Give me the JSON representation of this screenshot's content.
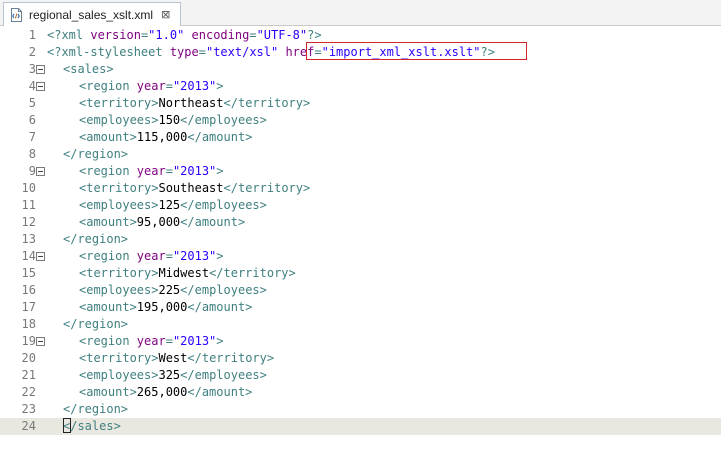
{
  "tab": {
    "icon": "xml-file-icon",
    "title": "regional_sales_xslt.xml",
    "close_glyph": "⊠"
  },
  "editor": {
    "current_line": 24,
    "highlight": "href=\"import_xml_xslt.xslt\"",
    "lines": [
      {
        "n": "1",
        "indent": 0,
        "fold": false,
        "parts": [
          [
            "pi",
            "<?xml "
          ],
          [
            "attr",
            "version"
          ],
          [
            "pi",
            "="
          ],
          [
            "val",
            "\"1.0\""
          ],
          [
            "pi",
            " "
          ],
          [
            "attr",
            "encoding"
          ],
          [
            "pi",
            "="
          ],
          [
            "val",
            "\"UTF-8\""
          ],
          [
            "pi",
            "?>"
          ]
        ]
      },
      {
        "n": "2",
        "indent": 0,
        "fold": false,
        "parts": [
          [
            "pi",
            "<?xml-stylesheet "
          ],
          [
            "attr",
            "type"
          ],
          [
            "pi",
            "="
          ],
          [
            "val",
            "\"text/xsl\""
          ],
          [
            "pi",
            " "
          ],
          [
            "attr",
            "href"
          ],
          [
            "pi",
            "="
          ],
          [
            "val",
            "\"import_xml_xslt.xslt\""
          ],
          [
            "pi",
            "?>"
          ]
        ]
      },
      {
        "n": "3",
        "indent": 1,
        "fold": true,
        "parts": [
          [
            "tag",
            "<sales>"
          ]
        ]
      },
      {
        "n": "4",
        "indent": 2,
        "fold": true,
        "parts": [
          [
            "tag",
            "<region "
          ],
          [
            "attr",
            "year"
          ],
          [
            "tag",
            "="
          ],
          [
            "val",
            "\"2013\""
          ],
          [
            "tag",
            ">"
          ]
        ]
      },
      {
        "n": "5",
        "indent": 2,
        "fold": false,
        "parts": [
          [
            "tag",
            "<territory>"
          ],
          [
            "text",
            "Northeast"
          ],
          [
            "tag",
            "</territory>"
          ]
        ]
      },
      {
        "n": "6",
        "indent": 2,
        "fold": false,
        "parts": [
          [
            "tag",
            "<employees>"
          ],
          [
            "text",
            "150"
          ],
          [
            "tag",
            "</employees>"
          ]
        ]
      },
      {
        "n": "7",
        "indent": 2,
        "fold": false,
        "parts": [
          [
            "tag",
            "<amount>"
          ],
          [
            "text",
            "115,000"
          ],
          [
            "tag",
            "</amount>"
          ]
        ]
      },
      {
        "n": "8",
        "indent": 1,
        "fold": false,
        "parts": [
          [
            "tag",
            "</region>"
          ]
        ]
      },
      {
        "n": "9",
        "indent": 2,
        "fold": true,
        "parts": [
          [
            "tag",
            "<region "
          ],
          [
            "attr",
            "year"
          ],
          [
            "tag",
            "="
          ],
          [
            "val",
            "\"2013\""
          ],
          [
            "tag",
            ">"
          ]
        ]
      },
      {
        "n": "10",
        "indent": 2,
        "fold": false,
        "parts": [
          [
            "tag",
            "<territory>"
          ],
          [
            "text",
            "Southeast"
          ],
          [
            "tag",
            "</territory>"
          ]
        ]
      },
      {
        "n": "11",
        "indent": 2,
        "fold": false,
        "parts": [
          [
            "tag",
            "<employees>"
          ],
          [
            "text",
            "125"
          ],
          [
            "tag",
            "</employees>"
          ]
        ]
      },
      {
        "n": "12",
        "indent": 2,
        "fold": false,
        "parts": [
          [
            "tag",
            "<amount>"
          ],
          [
            "text",
            "95,000"
          ],
          [
            "tag",
            "</amount>"
          ]
        ]
      },
      {
        "n": "13",
        "indent": 1,
        "fold": false,
        "parts": [
          [
            "tag",
            "</region>"
          ]
        ]
      },
      {
        "n": "14",
        "indent": 2,
        "fold": true,
        "parts": [
          [
            "tag",
            "<region "
          ],
          [
            "attr",
            "year"
          ],
          [
            "tag",
            "="
          ],
          [
            "val",
            "\"2013\""
          ],
          [
            "tag",
            ">"
          ]
        ]
      },
      {
        "n": "15",
        "indent": 2,
        "fold": false,
        "parts": [
          [
            "tag",
            "<territory>"
          ],
          [
            "text",
            "Midwest"
          ],
          [
            "tag",
            "</territory>"
          ]
        ]
      },
      {
        "n": "16",
        "indent": 2,
        "fold": false,
        "parts": [
          [
            "tag",
            "<employees>"
          ],
          [
            "text",
            "225"
          ],
          [
            "tag",
            "</employees>"
          ]
        ]
      },
      {
        "n": "17",
        "indent": 2,
        "fold": false,
        "parts": [
          [
            "tag",
            "<amount>"
          ],
          [
            "text",
            "195,000"
          ],
          [
            "tag",
            "</amount>"
          ]
        ]
      },
      {
        "n": "18",
        "indent": 1,
        "fold": false,
        "parts": [
          [
            "tag",
            "</region>"
          ]
        ]
      },
      {
        "n": "19",
        "indent": 2,
        "fold": true,
        "parts": [
          [
            "tag",
            "<region "
          ],
          [
            "attr",
            "year"
          ],
          [
            "tag",
            "="
          ],
          [
            "val",
            "\"2013\""
          ],
          [
            "tag",
            ">"
          ]
        ]
      },
      {
        "n": "20",
        "indent": 2,
        "fold": false,
        "parts": [
          [
            "tag",
            "<territory>"
          ],
          [
            "text",
            "West"
          ],
          [
            "tag",
            "</territory>"
          ]
        ]
      },
      {
        "n": "21",
        "indent": 2,
        "fold": false,
        "parts": [
          [
            "tag",
            "<employees>"
          ],
          [
            "text",
            "325"
          ],
          [
            "tag",
            "</employees>"
          ]
        ]
      },
      {
        "n": "22",
        "indent": 2,
        "fold": false,
        "parts": [
          [
            "tag",
            "<amount>"
          ],
          [
            "text",
            "265,000"
          ],
          [
            "tag",
            "</amount>"
          ]
        ]
      },
      {
        "n": "23",
        "indent": 1,
        "fold": false,
        "parts": [
          [
            "tag",
            "</region>"
          ]
        ]
      },
      {
        "n": "24",
        "indent": 1,
        "fold": false,
        "parts": [
          [
            "tag",
            "</sales>"
          ]
        ]
      }
    ]
  },
  "colors": {
    "tag": "#3f7f7f",
    "attribute": "#7f007f",
    "value": "#2a00ff",
    "text": "#000000",
    "current_line_bg": "#e8e8e0",
    "highlight_border": "#d2232a"
  }
}
